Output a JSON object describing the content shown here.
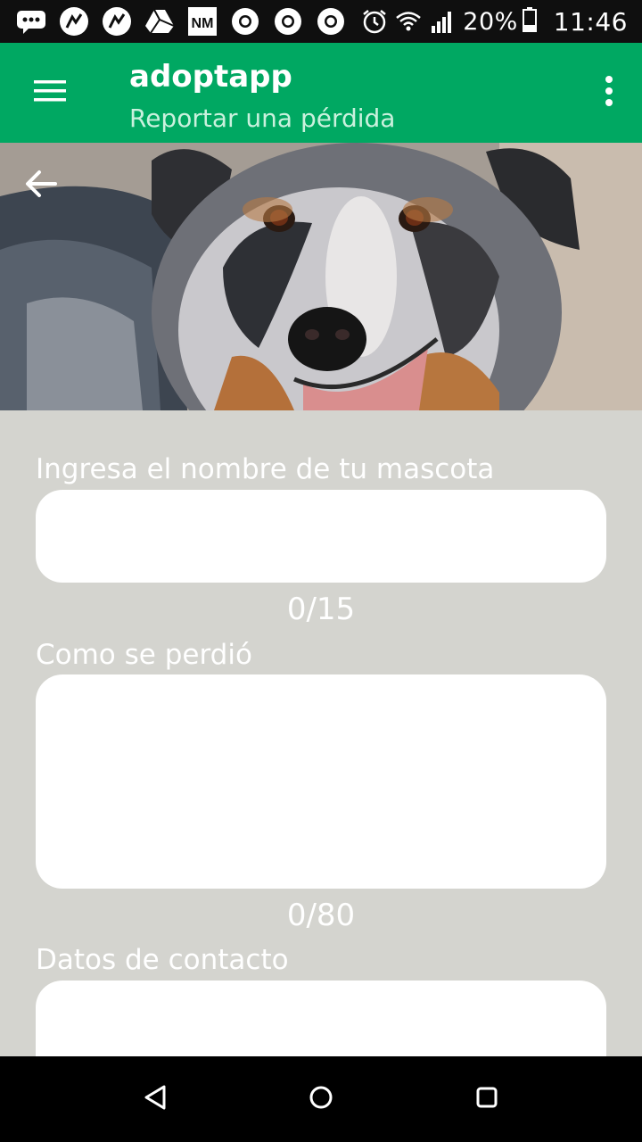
{
  "status_bar": {
    "notification_icons": [
      "message-icon",
      "app-icon",
      "app-icon",
      "drive-icon",
      "nm-icon",
      "chrome-icon",
      "chrome-icon",
      "chrome-icon"
    ],
    "battery_percent": "20%",
    "time": "11:46"
  },
  "app_bar": {
    "title": "adoptapp",
    "subtitle": "Reportar una pérdida"
  },
  "form": {
    "pet_name": {
      "label": "Ingresa el nombre de tu mascota",
      "value": "",
      "counter": "0/15"
    },
    "how_lost": {
      "label": "Como se perdió",
      "value": "",
      "counter": "0/80"
    },
    "contact": {
      "label": "Datos de contacto",
      "value": ""
    }
  },
  "colors": {
    "app_bar": "#00a862",
    "background": "#d4d4cf",
    "status_bar": "#0f0f0f"
  }
}
